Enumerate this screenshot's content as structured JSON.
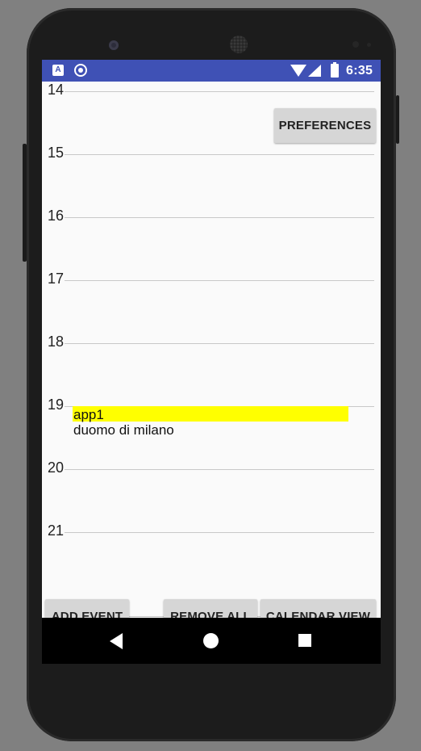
{
  "status_bar": {
    "notification_icons": [
      "a-box-icon",
      "circle-icon"
    ],
    "indicator_icons": [
      "wifi-icon",
      "cell-signal-icon",
      "battery-icon"
    ],
    "time": "6:35",
    "background_color": "#3f51b5"
  },
  "calendar": {
    "hours": [
      "14",
      "15",
      "16",
      "17",
      "18",
      "19",
      "20",
      "21"
    ],
    "events": [
      {
        "title": "app1",
        "location": "duomo di milano",
        "highlight_color": "#ffff00"
      }
    ]
  },
  "buttons": {
    "preferences": "PREFERENCES",
    "add_event": "ADD EVENT",
    "remove_all": "REMOVE ALL",
    "calendar_view": "CALENDAR VIEW"
  },
  "nav_bar": {
    "icons": [
      "back-icon",
      "home-icon",
      "recents-icon"
    ]
  }
}
